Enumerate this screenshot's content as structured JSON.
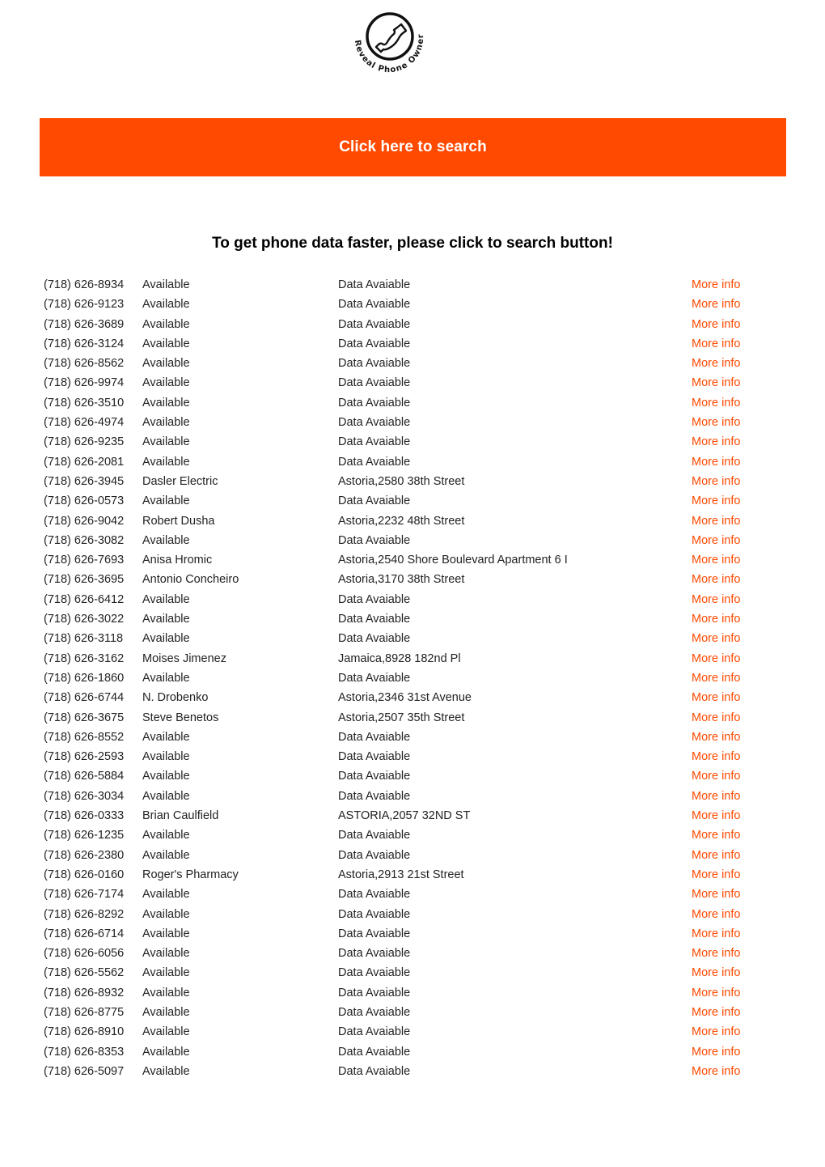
{
  "logo": {
    "icon": "phone-handset-icon",
    "text": "Reveal Phone Owner"
  },
  "banner": {
    "label": "Click here to search",
    "color": "#ff4a00"
  },
  "headline": "To get phone data faster, please click to search button!",
  "more_info_label": "More info",
  "rows": [
    {
      "phone": "(718) 626-8934",
      "name": "Available",
      "address": "Data Avaiable",
      "link": "More info"
    },
    {
      "phone": "(718) 626-9123",
      "name": "Available",
      "address": "Data Avaiable",
      "link": "More info"
    },
    {
      "phone": "(718) 626-3689",
      "name": "Available",
      "address": "Data Avaiable",
      "link": "More info"
    },
    {
      "phone": "(718) 626-3124",
      "name": "Available",
      "address": "Data Avaiable",
      "link": "More info"
    },
    {
      "phone": "(718) 626-8562",
      "name": "Available",
      "address": "Data Avaiable",
      "link": "More info"
    },
    {
      "phone": "(718) 626-9974",
      "name": "Available",
      "address": "Data Avaiable",
      "link": "More info"
    },
    {
      "phone": "(718) 626-3510",
      "name": "Available",
      "address": "Data Avaiable",
      "link": "More info"
    },
    {
      "phone": "(718) 626-4974",
      "name": "Available",
      "address": "Data Avaiable",
      "link": "More info"
    },
    {
      "phone": "(718) 626-9235",
      "name": "Available",
      "address": "Data Avaiable",
      "link": "More info"
    },
    {
      "phone": "(718) 626-2081",
      "name": "Available",
      "address": "Data Avaiable",
      "link": "More info"
    },
    {
      "phone": "(718) 626-3945",
      "name": "Dasler Electric",
      "address": "Astoria,2580 38th Street",
      "link": "More info"
    },
    {
      "phone": "(718) 626-0573",
      "name": "Available",
      "address": "Data Avaiable",
      "link": "More info"
    },
    {
      "phone": "(718) 626-9042",
      "name": "Robert Dusha",
      "address": "Astoria,2232 48th Street",
      "link": "More info"
    },
    {
      "phone": "(718) 626-3082",
      "name": "Available",
      "address": "Data Avaiable",
      "link": "More info"
    },
    {
      "phone": "(718) 626-7693",
      "name": "Anisa Hromic",
      "address": "Astoria,2540 Shore Boulevard Apartment 6 I",
      "link": "More info"
    },
    {
      "phone": "(718) 626-3695",
      "name": "Antonio Concheiro",
      "address": "Astoria,3170 38th Street",
      "link": "More info"
    },
    {
      "phone": "(718) 626-6412",
      "name": "Available",
      "address": "Data Avaiable",
      "link": "More info"
    },
    {
      "phone": "(718) 626-3022",
      "name": "Available",
      "address": "Data Avaiable",
      "link": "More info"
    },
    {
      "phone": "(718) 626-3118",
      "name": "Available",
      "address": "Data Avaiable",
      "link": "More info"
    },
    {
      "phone": "(718) 626-3162",
      "name": "Moises  Jimenez",
      "address": "Jamaica,8928 182nd Pl",
      "link": "More info"
    },
    {
      "phone": "(718) 626-1860",
      "name": "Available",
      "address": "Data Avaiable",
      "link": "More info"
    },
    {
      "phone": "(718) 626-6744",
      "name": "N. Drobenko",
      "address": "Astoria,2346 31st Avenue",
      "link": "More info"
    },
    {
      "phone": "(718) 626-3675",
      "name": "Steve Benetos",
      "address": "Astoria,2507 35th Street",
      "link": "More info"
    },
    {
      "phone": "(718) 626-8552",
      "name": "Available",
      "address": "Data Avaiable",
      "link": "More info"
    },
    {
      "phone": "(718) 626-2593",
      "name": "Available",
      "address": "Data Avaiable",
      "link": "More info"
    },
    {
      "phone": "(718) 626-5884",
      "name": "Available",
      "address": "Data Avaiable",
      "link": "More info"
    },
    {
      "phone": "(718) 626-3034",
      "name": "Available",
      "address": "Data Avaiable",
      "link": "More info"
    },
    {
      "phone": "(718) 626-0333",
      "name": "Brian Caulfield",
      "address": "ASTORIA,2057 32ND ST",
      "link": "More info"
    },
    {
      "phone": "(718) 626-1235",
      "name": "Available",
      "address": "Data Avaiable",
      "link": "More info"
    },
    {
      "phone": "(718) 626-2380",
      "name": "Available",
      "address": "Data Avaiable",
      "link": "More info"
    },
    {
      "phone": "(718) 626-0160",
      "name": "Roger's Pharmacy",
      "address": "Astoria,2913 21st Street",
      "link": "More info"
    },
    {
      "phone": "(718) 626-7174",
      "name": "Available",
      "address": "Data Avaiable",
      "link": "More info"
    },
    {
      "phone": "(718) 626-8292",
      "name": "Available",
      "address": "Data Avaiable",
      "link": "More info"
    },
    {
      "phone": "(718) 626-6714",
      "name": "Available",
      "address": "Data Avaiable",
      "link": "More info"
    },
    {
      "phone": "(718) 626-6056",
      "name": "Available",
      "address": "Data Avaiable",
      "link": "More info"
    },
    {
      "phone": "(718) 626-5562",
      "name": "Available",
      "address": "Data Avaiable",
      "link": "More info"
    },
    {
      "phone": "(718) 626-8932",
      "name": "Available",
      "address": "Data Avaiable",
      "link": "More info"
    },
    {
      "phone": "(718) 626-8775",
      "name": "Available",
      "address": "Data Avaiable",
      "link": "More info"
    },
    {
      "phone": "(718) 626-8910",
      "name": "Available",
      "address": "Data Avaiable",
      "link": "More info"
    },
    {
      "phone": "(718) 626-8353",
      "name": "Available",
      "address": "Data Avaiable",
      "link": "More info"
    },
    {
      "phone": "(718) 626-5097",
      "name": "Available",
      "address": "Data Avaiable",
      "link": "More info"
    }
  ]
}
